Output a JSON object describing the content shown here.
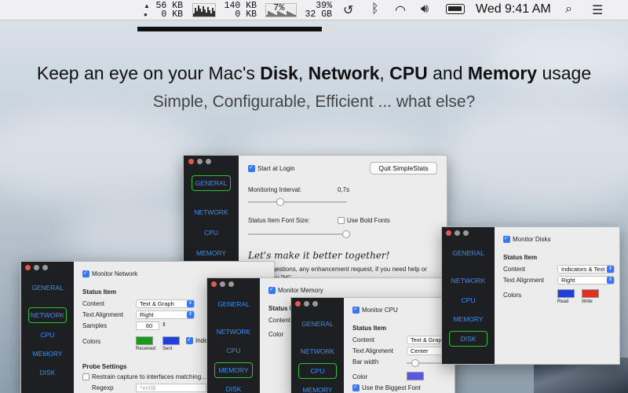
{
  "menubar": {
    "net_up": "56 KB",
    "net_down": "0 KB",
    "disk_read": "140 KB",
    "disk_write": "0 KB",
    "cpu": "7%",
    "mem_pct": "39%",
    "mem_total": "32 GB",
    "clock": "Wed 9:41 AM",
    "icons": [
      "time-machine-icon",
      "bluetooth-icon",
      "wifi-icon",
      "volume-icon",
      "battery-icon",
      "search-icon",
      "list-icon"
    ]
  },
  "progress": 0.94,
  "headline": {
    "prefix": "Keep an eye on your Mac's ",
    "disk": "Disk",
    "sep1": ", ",
    "network": "Network",
    "sep2": ", ",
    "cpu": "CPU",
    "and": " and ",
    "memory": "Memory",
    "suffix": " usage"
  },
  "subline": "Simple, Configurable, Efficient ... what else?",
  "general_window": {
    "nav": [
      "GENERAL",
      "NETWORK",
      "CPU",
      "MEMORY"
    ],
    "start_at_login": "Start at Login",
    "quit_button": "Quit SimpleStats",
    "monitoring_interval_label": "Monitoring Interval:",
    "monitoring_interval_value": "0,7s",
    "font_size_label": "Status Item Font Size:",
    "bold_fonts": "Use Bold Fonts",
    "script": "Let's make it better together!",
    "suggestion_1": "suggestions, any enhancement request, if you need help or",
    "suggestion_2": "to say \"Hi\""
  },
  "network_window": {
    "nav": [
      "GENERAL",
      "NETWORK",
      "CPU",
      "MEMORY",
      "DISK"
    ],
    "monitor": "Monitor Network",
    "status_item": "Status Item",
    "content_label": "Content",
    "content_value": "Text & Graph",
    "alignment_label": "Text Alignment",
    "alignment_value": "Right",
    "samples_label": "Samples",
    "samples_value": "60",
    "colors_label": "Colors",
    "received": "Received",
    "sent": "Sent",
    "indep": "Indep",
    "probe": "Probe Settings",
    "restrain": "Restrain capture to interfaces matching...",
    "regexp_label": "Regexp",
    "regexp_placeholder": "^en0$",
    "colors": {
      "received": "#1a9a1a",
      "sent": "#1f3fe0"
    }
  },
  "memory_window": {
    "nav": [
      "GENERAL",
      "NETWORK",
      "CPU",
      "MEMORY",
      "DISK"
    ],
    "monitor": "Monitor Memory",
    "status_item_partial": "Status It",
    "content_partial": "Content",
    "color_partial": "Color"
  },
  "cpu_window": {
    "nav": [
      "GENERAL",
      "NETWORK",
      "CPU",
      "MEMORY"
    ],
    "monitor": "Monitor CPU",
    "status_item": "Status Item",
    "content_label": "Content",
    "content_value": "Text & Graph",
    "alignment_label": "Text Alignment",
    "alignment_value": "Center",
    "bar_width_label": "Bar width",
    "color_label": "Color",
    "biggest_font": "Use the Biggest Font",
    "color": "#5b55e8"
  },
  "disk_window": {
    "nav": [
      "GENERAL",
      "NETWORK",
      "CPU",
      "MEMORY",
      "DISK"
    ],
    "monitor": "Monitor Disks",
    "status_item": "Status Item",
    "content_label": "Content",
    "content_value": "Indicators & Text",
    "alignment_label": "Text Alignment",
    "alignment_value": "Right",
    "colors_label": "Colors",
    "read": "Read",
    "write": "Write",
    "colors": {
      "read": "#1f3fe0",
      "write": "#e03020"
    }
  }
}
